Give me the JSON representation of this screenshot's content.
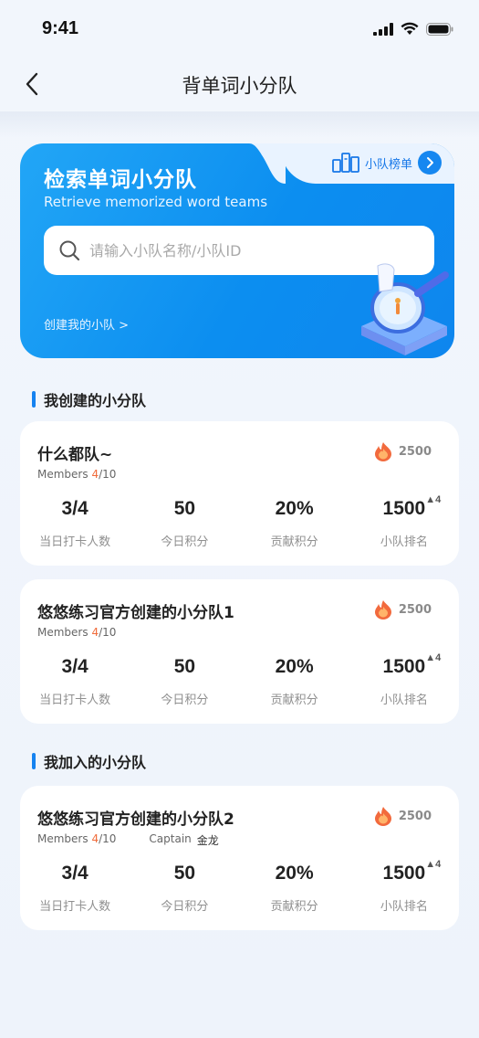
{
  "status": {
    "time": "9:41"
  },
  "nav": {
    "title": "背单词小分队"
  },
  "hero": {
    "title": "检索单词小分队",
    "subtitle": "Retrieve memorized word teams",
    "ranking_label": "小队榜单",
    "search_placeholder": "请输入小队名称/小队ID",
    "search_value": "",
    "create_link": "创建我的小队 >"
  },
  "sections": {
    "created": "我创建的小分队",
    "joined": "我加入的小分队"
  },
  "stat_labels": [
    "当日打卡人数",
    "今日积分",
    "贡献积分",
    "小队排名"
  ],
  "teams": [
    {
      "name": "什么都队~",
      "score": "2500",
      "members_label": "Members",
      "members_current": "4",
      "members_total": "/10",
      "stats": [
        "3/4",
        "50",
        "20%",
        "1500"
      ],
      "rank_change": "4"
    },
    {
      "name": "悠悠练习官方创建的小分队1",
      "score": "2500",
      "members_label": "Members",
      "members_current": "4",
      "members_total": "/10",
      "stats": [
        "3/4",
        "50",
        "20%",
        "1500"
      ],
      "rank_change": "4"
    },
    {
      "name": "悠悠练习官方创建的小分队2",
      "score": "2500",
      "members_label": "Members",
      "members_current": "4",
      "members_total": "/10",
      "captain_label": "Captain",
      "captain_name": "金龙",
      "stats": [
        "3/4",
        "50",
        "20%",
        "1500"
      ],
      "rank_change": "4"
    }
  ],
  "colors": {
    "accent": "#1582f0",
    "highlight": "#f06b3a",
    "background": "#f2f6fc"
  },
  "icons": [
    "signal-icon",
    "wifi-icon",
    "battery-icon",
    "back-icon",
    "ranking-icon",
    "chevron-right-icon",
    "search-icon",
    "flame-icon"
  ]
}
